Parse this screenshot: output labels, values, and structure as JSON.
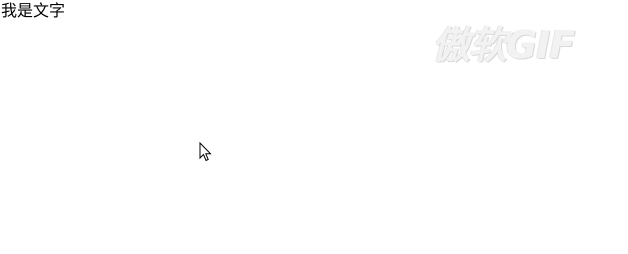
{
  "content": {
    "text": "我是文字"
  },
  "watermark": {
    "text": "傲软GIF",
    "color": "#f2f2f2"
  },
  "cursor": {
    "icon": "arrow-cursor-icon"
  }
}
